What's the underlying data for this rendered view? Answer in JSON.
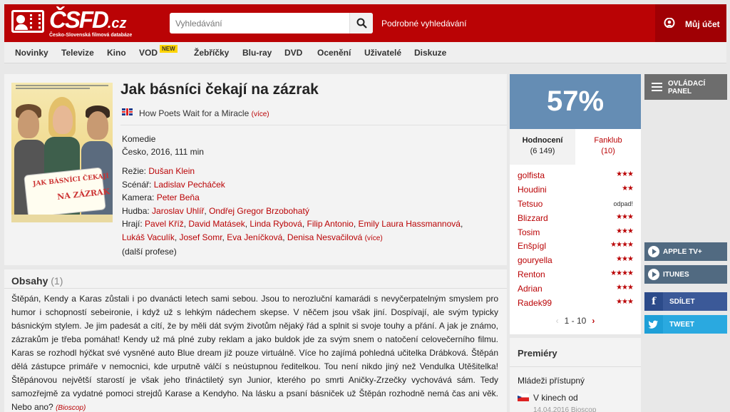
{
  "header": {
    "logo_text": "ČSFD",
    "logo_tld": ".cz",
    "logo_subtitle": "Česko-Slovenská filmová databáze",
    "search_placeholder": "Vyhledávání",
    "advanced_search": "Podrobné vyhledávání",
    "account": "Můj účet"
  },
  "nav": {
    "items": [
      "Novinky",
      "Televize",
      "Kino",
      "VOD",
      "Žebříčky",
      "Blu-ray",
      "DVD",
      "Ocenění",
      "Uživatelé",
      "Diskuze"
    ],
    "badge": "NEW"
  },
  "film": {
    "title": "Jak básníci čekají na zázrak",
    "alt_title": "How Poets Wait for a Miracle",
    "alt_more": "(více)",
    "genre": "Komedie",
    "origin": "Česko, 2016, 111 min",
    "poster_title_1": "JAK BÁSNÍCI ČEKAJÍ",
    "poster_title_2": "NA ZÁZRAK",
    "directing_label": "Režie:",
    "director": "Dušan Klein",
    "screenplay_label": "Scénář:",
    "writer": "Ladislav Pecháček",
    "camera_label": "Kamera:",
    "camera": "Peter Beňa",
    "music_label": "Hudba:",
    "music": [
      "Jaroslav Uhlíř",
      "Ondřej Gregor Brzobohatý"
    ],
    "cast_label": "Hrají:",
    "cast": [
      "Pavel Kříž",
      "David Matásek",
      "Linda Rybová",
      "Filip Antonio",
      "Emily Laura Hassmannová",
      "Lukáš Vaculík",
      "Josef Somr",
      "Eva Jeníčková",
      "Denisa Nesvačilová"
    ],
    "cast_more": "(více)",
    "more_professions": "(další profese)"
  },
  "plot": {
    "heading": "Obsahy",
    "count": "(1)",
    "text": "Štěpán, Kendy a Karas zůstali i po dvanácti letech sami sebou. Jsou to nerozluční kamarádi s nevyčerpatelným smyslem pro humor i schopností sebeironie, i když už s lehkým nádechem skepse. V něčem jsou však jiní. Dospívají, ale svým typicky básnickým stylem. Je jim padesát a cítí, že by měli dát svým životům nějaký řád a splnit si svoje touhy a přání. A jak je známo, zázrakům je třeba pomáhat! Kendy už má plné zuby reklam a jako buldok jde za svým snem o natočení celovečerního filmu. Karas se rozhodl hýčkat své vysněné auto Blue dream již pouze virtuálně. Více ho zajímá pohledná učitelka Drábková. Štěpán dělá zástupce primáře v nemocnici, kde urputně válčí s neústupnou ředitelkou. Tou není nikdo jiný než Vendulka Utěšitelka! Štěpánovou největší starostí je však jeho třináctiletý syn Junior, kterého po smrti Aničky-Zrzečky vychovává sám. Tedy samozřejmě za vydatné pomoci strejdů Karase a Kendyho. Na lásku a psaní básniček už Štěpán rozhodně nemá čas ani věk. Nebo ano?",
    "source": "(Bioscop)"
  },
  "rating": {
    "percent": "57%",
    "tab_ratings": "Hodnocení",
    "tab_ratings_count": "(6 149)",
    "tab_fanclub": "Fanklub",
    "tab_fanclub_count": "(10)",
    "users": [
      {
        "name": "golfista",
        "stars": 3
      },
      {
        "name": "Houdini",
        "stars": 2
      },
      {
        "name": "Tetsuo",
        "text": "odpad!"
      },
      {
        "name": "Blizzard",
        "stars": 3
      },
      {
        "name": "Tosim",
        "stars": 3
      },
      {
        "name": "Enšpígl",
        "stars": 4
      },
      {
        "name": "gouryella",
        "stars": 3
      },
      {
        "name": "Renton",
        "stars": 4
      },
      {
        "name": "Adrian",
        "stars": 3
      },
      {
        "name": "Radek99",
        "stars": 3
      }
    ],
    "pager": "1 - 10"
  },
  "premiere": {
    "heading": "Premiéry",
    "rating_note": "Mládeži přístupný",
    "cinema": "V kinech od",
    "date": "14.04.2016 Bioscop"
  },
  "side": {
    "panel": "OVLÁDACÍ PANEL",
    "apple": "APPLE TV+",
    "itunes": "ITUNES",
    "share": "SDÍLET",
    "tweet": "TWEET"
  },
  "colors": {
    "brand_red": "#ba0305",
    "rating_blue": "#658db4"
  }
}
